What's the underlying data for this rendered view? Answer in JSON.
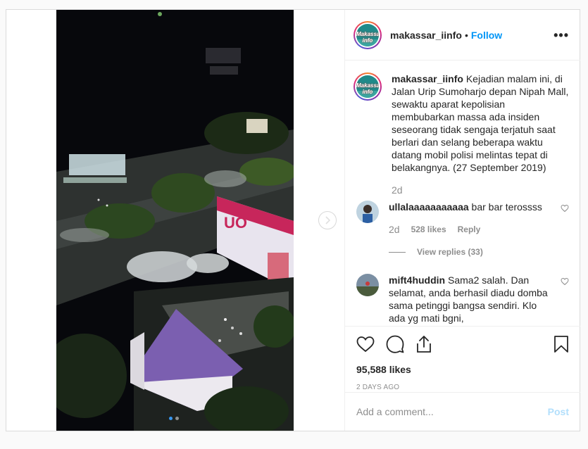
{
  "header": {
    "username": "makassar_iinfo",
    "separator": "•",
    "follow_label": "Follow",
    "more_label": "•••",
    "avatar_text": "Makassar info"
  },
  "caption": {
    "username": "makassar_iinfo",
    "text": "Kejadian malam ini, di Jalan Urip Sumoharjo depan Nipah Mall, sewaktu aparat kepolisian membubarkan massa ada insiden seseorang tidak sengaja terjatuh saat berlari dan selang beberapa waktu datang mobil polisi melintas tepat di belakangnya. (27 September 2019)",
    "time": "2d"
  },
  "comments": [
    {
      "username": "ullalaaaaaaaaaaa",
      "text": "bar bar terossss",
      "time": "2d",
      "likes": "528 likes",
      "reply_label": "Reply",
      "view_replies": "View replies (33)"
    },
    {
      "username": "mift4huddin",
      "text": "Sama2 salah. Dan selamat, anda berhasil diadu domba sama petinggi bangsa sendiri. Klo ada yg mati bgni,"
    }
  ],
  "stats": {
    "likes": "95,588 likes",
    "posted_ago": "2 DAYS AGO"
  },
  "composer": {
    "placeholder": "Add a comment...",
    "post_label": "Post"
  },
  "media": {
    "slide_count": 2,
    "active_slide": 1
  },
  "colors": {
    "accent": "#0095f6",
    "post_disabled": "#b2dffc",
    "muted": "#8e8e8e",
    "border": "#dbdbdb"
  }
}
